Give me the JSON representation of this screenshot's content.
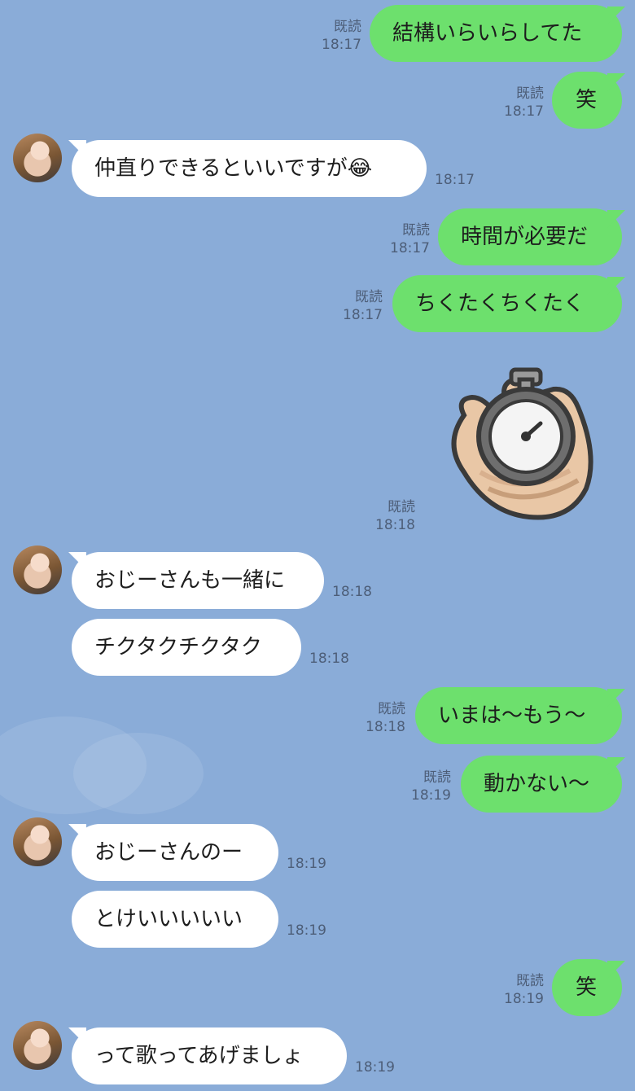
{
  "chat": {
    "messages": [
      {
        "dir": "out",
        "text": "結構いらいらしてた",
        "read": "既読",
        "time": "18:17"
      },
      {
        "dir": "out",
        "text": "笑",
        "read": "既読",
        "time": "18:17"
      },
      {
        "dir": "in",
        "text": "仲直りできるといいですが😂",
        "time": "18:17"
      },
      {
        "dir": "out",
        "text": "時間が必要だ",
        "read": "既読",
        "time": "18:17"
      },
      {
        "dir": "out",
        "text": "ちくたくちくたく",
        "read": "既読",
        "time": "18:17"
      },
      {
        "dir": "out",
        "sticker": "stopwatch-hand-sticker",
        "read": "既読",
        "time": "18:18"
      },
      {
        "dir": "in",
        "text": "おじーさんも一緒に",
        "time": "18:18"
      },
      {
        "dir": "in",
        "text": "チクタクチクタク",
        "time": "18:18"
      },
      {
        "dir": "out",
        "text": "いまは〜もう〜",
        "read": "既読",
        "time": "18:18"
      },
      {
        "dir": "out",
        "text": "動かない〜",
        "read": "既読",
        "time": "18:19"
      },
      {
        "dir": "in",
        "text": "おじーさんのー",
        "time": "18:19"
      },
      {
        "dir": "in",
        "text": "とけいいいいい",
        "time": "18:19"
      },
      {
        "dir": "out",
        "text": "笑",
        "read": "既読",
        "time": "18:19"
      },
      {
        "dir": "in",
        "text": "って歌ってあげましょ",
        "time": "18:19"
      }
    ]
  },
  "colors": {
    "background": "#8aacd8",
    "outgoing_bubble": "#6de06d",
    "incoming_bubble": "#ffffff",
    "meta_text": "#4d5e78"
  }
}
